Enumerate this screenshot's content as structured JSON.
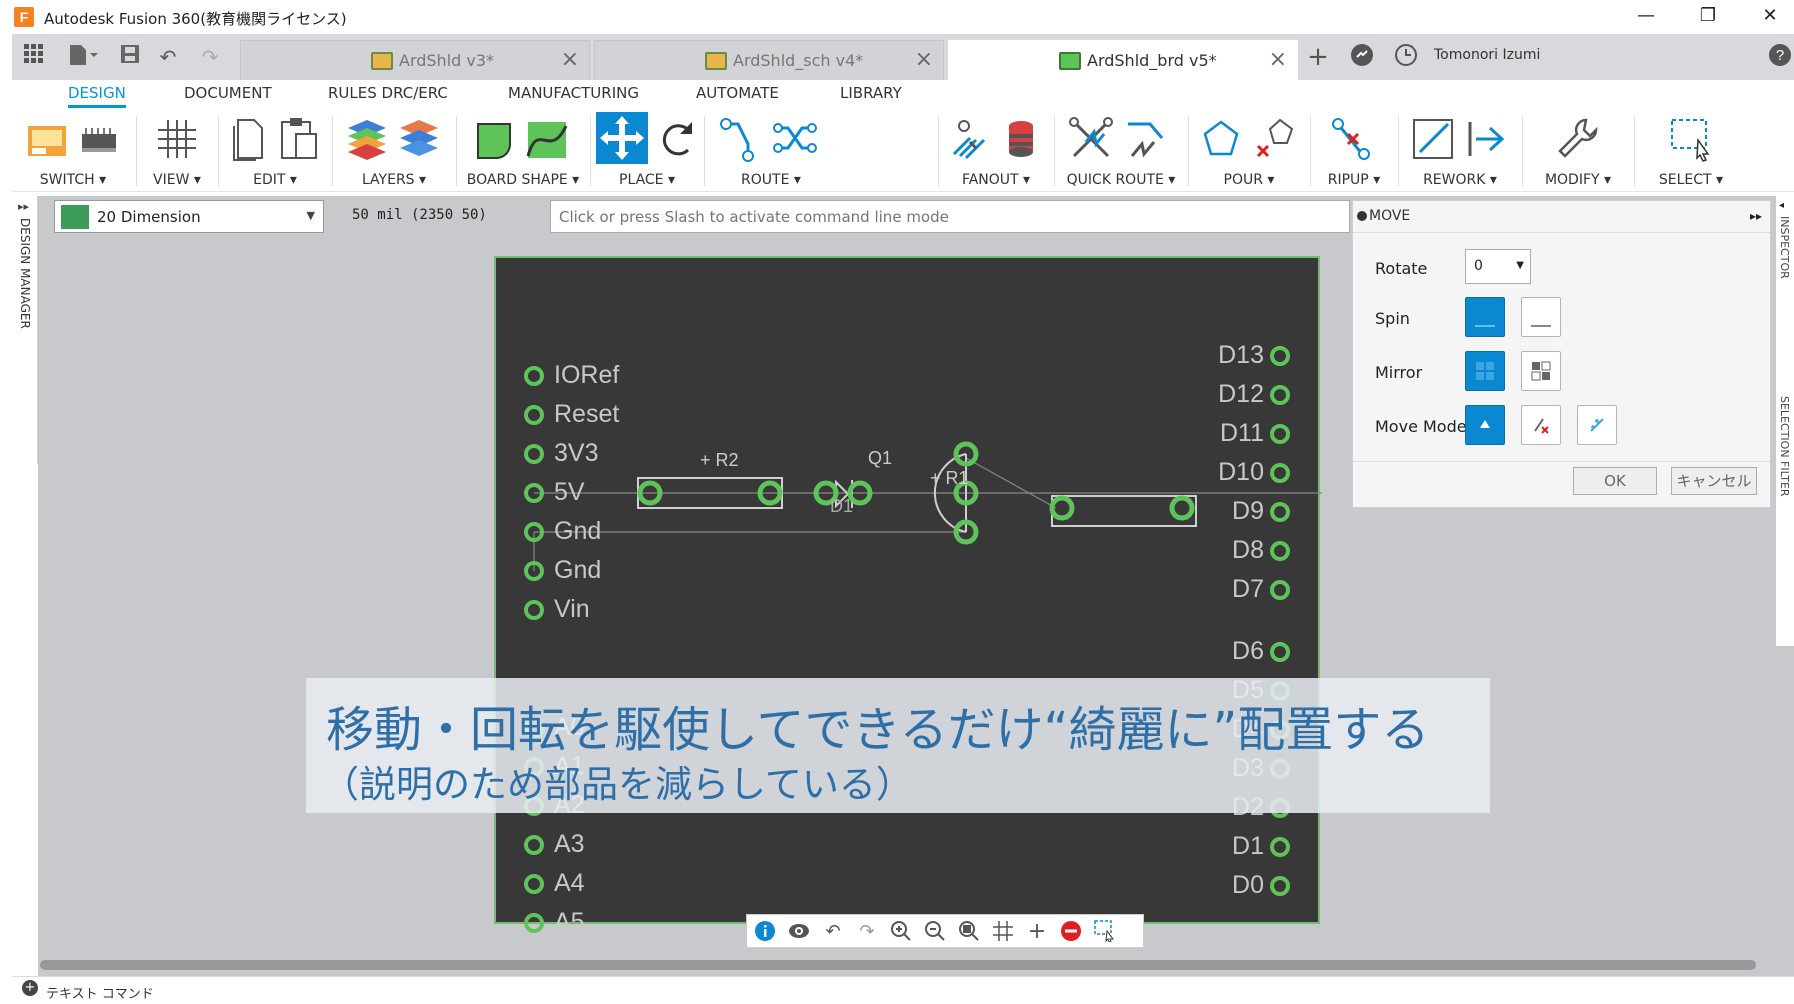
{
  "window": {
    "title": "Autodesk Fusion 360(教育機関ライセンス)",
    "logo_letter": "F",
    "min": "—",
    "restore": "❐",
    "close": "✕"
  },
  "tabs": [
    {
      "label": "ArdShld v3*",
      "active": false
    },
    {
      "label": "ArdShld_sch v4*",
      "active": false
    },
    {
      "label": "ArdShld_brd v5*",
      "active": true
    }
  ],
  "user": {
    "name": "Tomonori Izumi"
  },
  "menu": [
    "DESIGN",
    "DOCUMENT",
    "RULES DRC/ERC",
    "MANUFACTURING",
    "AUTOMATE",
    "LIBRARY"
  ],
  "toolbar_groups": [
    "SWITCH",
    "VIEW",
    "EDIT",
    "LAYERS",
    "BOARD SHAPE",
    "PLACE",
    "ROUTE",
    "FANOUT",
    "QUICK ROUTE",
    "POUR",
    "RIPUP",
    "REWORK",
    "MODIFY",
    "SELECT"
  ],
  "left_panel": {
    "label": "DESIGN MANAGER"
  },
  "layer": {
    "name": "20 Dimension",
    "color": "#3d9c59"
  },
  "grid_info": "50 mil (2350 50)",
  "command_line": {
    "placeholder": "Click or press Slash to activate command line mode"
  },
  "move_panel": {
    "title": "MOVE",
    "rotate_label": "Rotate",
    "rotate_value": "0",
    "spin_label": "Spin",
    "mirror_label": "Mirror",
    "move_mode_label": "Move Mode",
    "ok": "OK",
    "cancel": "キャンセル"
  },
  "right_strip": {
    "inspector": "INSPECTOR",
    "selection_filter": "SELECTION FILTER"
  },
  "board": {
    "left_pins": [
      "IORef",
      "Reset",
      "3V3",
      "5V",
      "Gnd",
      "Gnd",
      "Vin",
      "A0",
      "A1",
      "A2",
      "A3",
      "A4",
      "A5"
    ],
    "right_pins": [
      "D13",
      "D12",
      "D11",
      "D10",
      "D9",
      "D8",
      "D7",
      "D6",
      "D5",
      "D4",
      "D3",
      "D2",
      "D1",
      "D0"
    ],
    "parts": {
      "r2": "+ R2",
      "r1": "+ R1",
      "q1": "Q1",
      "d1": "D1"
    },
    "pad_color": "#5ec45a",
    "bg_color": "#383838"
  },
  "caption": {
    "main": "移動・回転を駆使してできるだけ“綺麗に”配置する",
    "sub": "（説明のため部品を減らしている）"
  },
  "status": {
    "text": "テキスト コマンド"
  }
}
